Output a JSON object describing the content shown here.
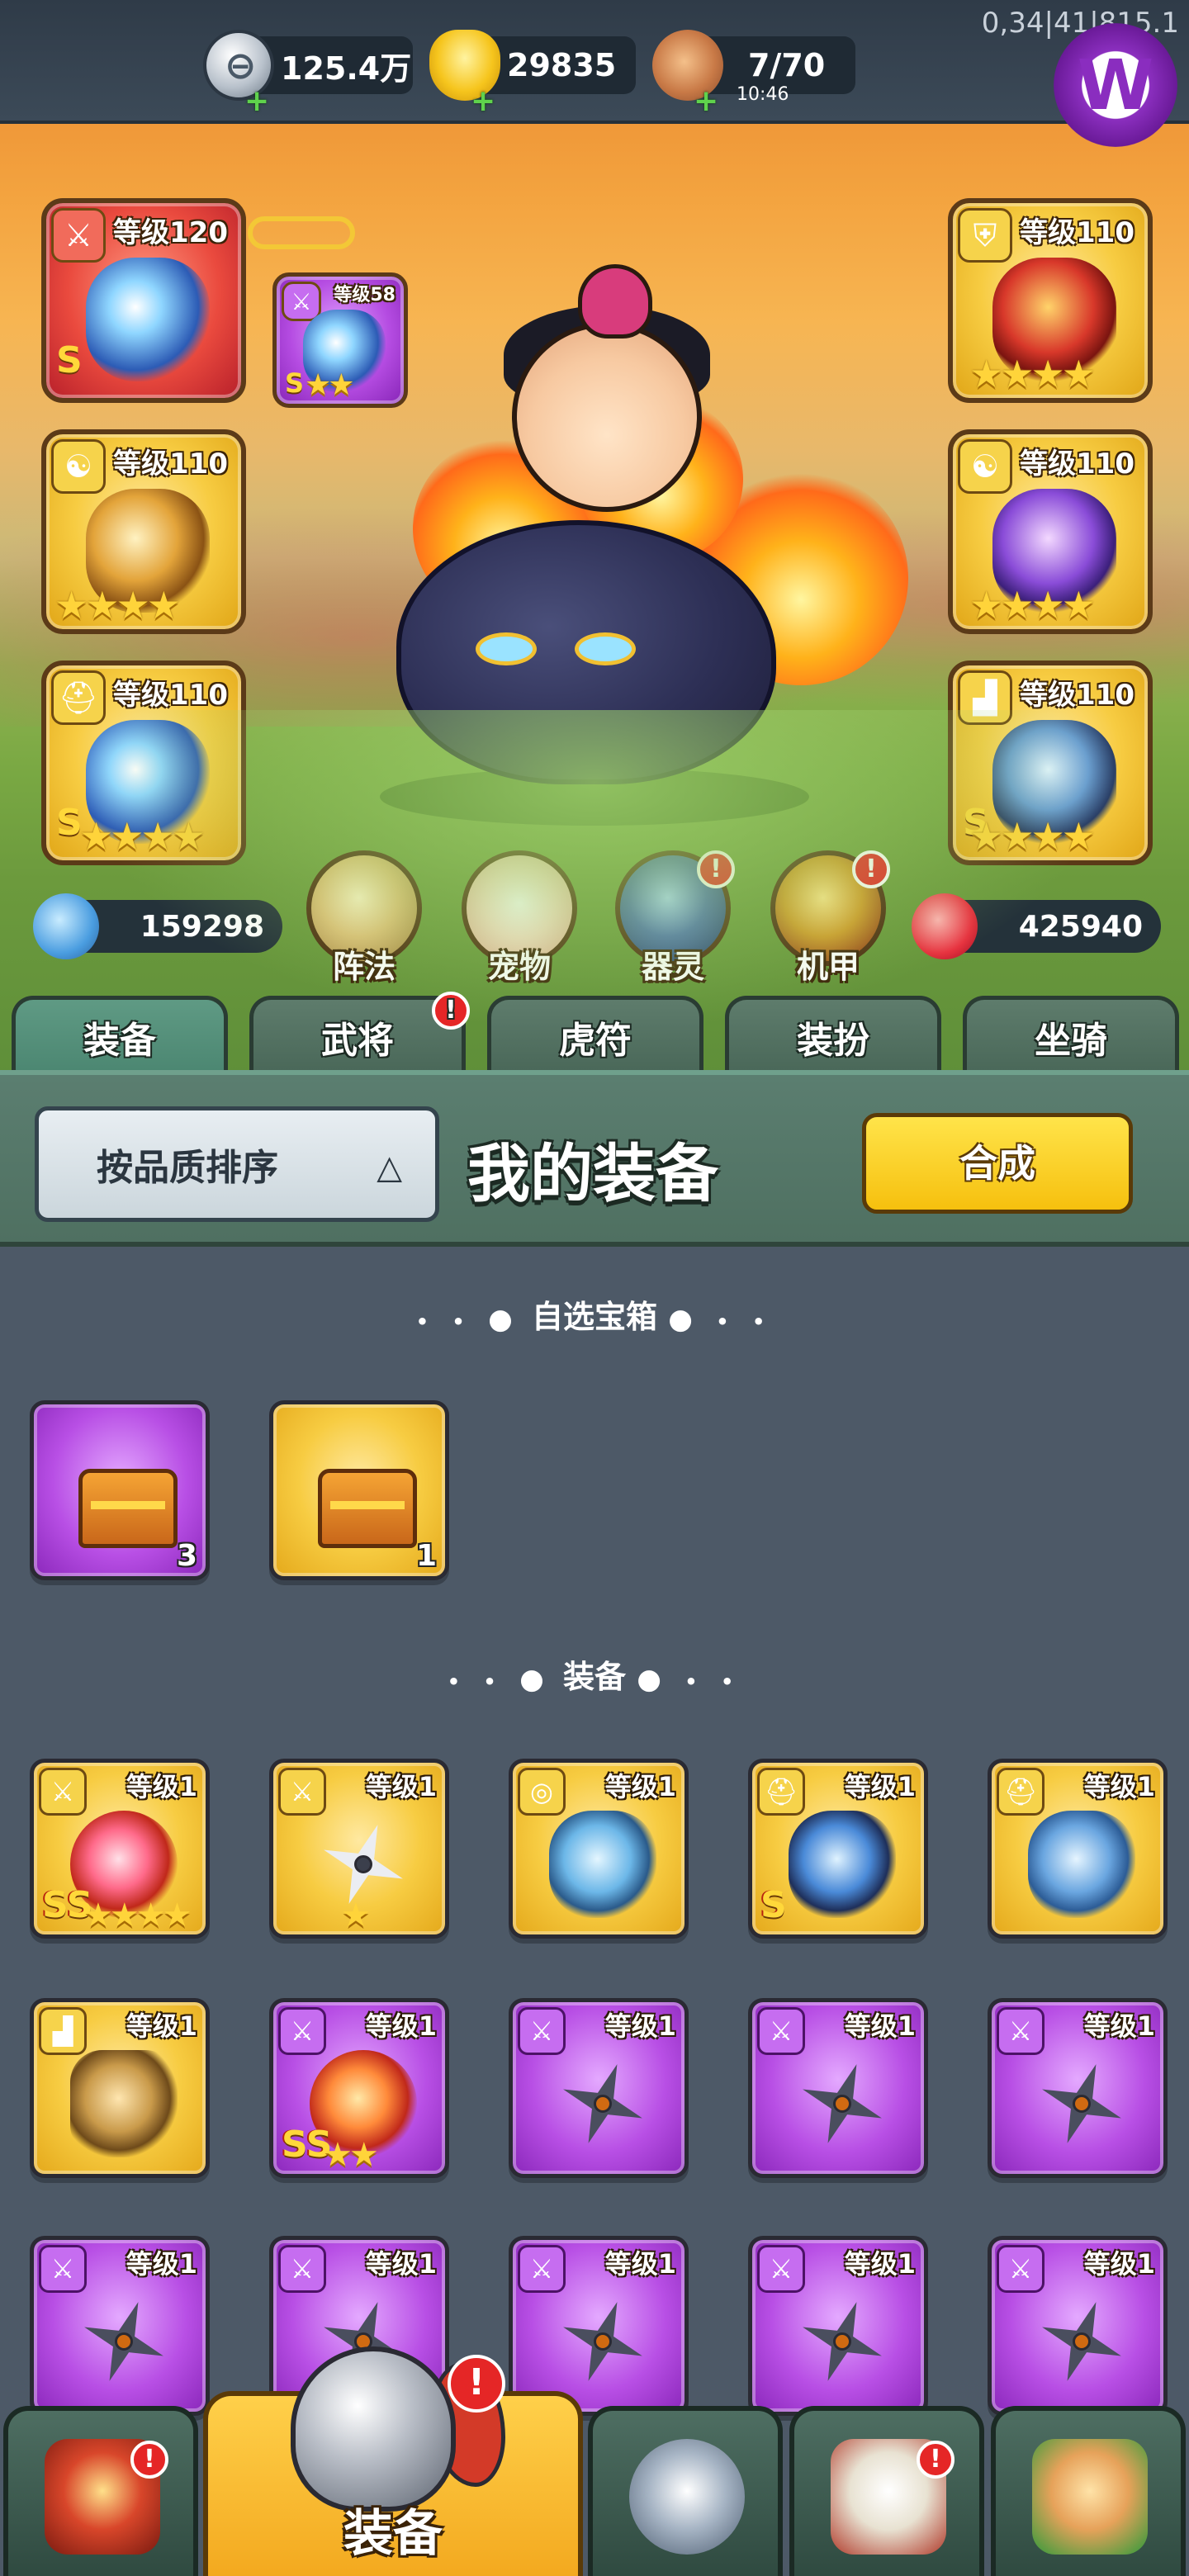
{
  "resources": {
    "silver": {
      "value": "125.4万",
      "icon": "silver-coin-icon"
    },
    "gold": {
      "value": "29835",
      "icon": "gold-ingot-icon"
    },
    "stamina": {
      "value": "7/70",
      "timer": "10:46",
      "icon": "meat-icon"
    }
  },
  "debug_text": "0,34|41|815.1",
  "hero_slots": {
    "weapon": {
      "level": "等级120",
      "grade": "S",
      "icon": "sword-icon"
    },
    "weapon_sub": {
      "level": "等级58",
      "grade": "S",
      "stars": "★★",
      "icon": "sword-icon"
    },
    "armor": {
      "level": "等级110",
      "stars": "★★★★",
      "icon": "armor-icon"
    },
    "accessory_left": {
      "level": "等级110",
      "stars": "★★★★",
      "icon": "yin-yang-icon"
    },
    "accessory_right": {
      "level": "等级110",
      "stars": "★★★★",
      "icon": "yin-yang-icon"
    },
    "helmet": {
      "level": "等级110",
      "grade": "S",
      "stars": "★★★★",
      "icon": "helmet-icon"
    },
    "boots": {
      "level": "等级110",
      "grade": "S",
      "stars": "★★★★",
      "icon": "boot-icon"
    }
  },
  "power": {
    "attack": "159298",
    "hp": "425940"
  },
  "features": [
    {
      "label": "阵法",
      "icon": "formation-icon",
      "alert": false
    },
    {
      "label": "宠物",
      "icon": "pet-cat-icon",
      "alert": false
    },
    {
      "label": "器灵",
      "icon": "spirit-icon",
      "alert": true
    },
    {
      "label": "机甲",
      "icon": "mecha-icon",
      "alert": true
    }
  ],
  "alert_mark": "!",
  "tabs": [
    {
      "label": "装备",
      "active": true,
      "alert": false
    },
    {
      "label": "武将",
      "active": false,
      "alert": true
    },
    {
      "label": "虎符",
      "active": false,
      "alert": false
    },
    {
      "label": "装扮",
      "active": false,
      "alert": false
    },
    {
      "label": "坐骑",
      "active": false,
      "alert": false
    }
  ],
  "panel": {
    "sort_label": "按品质排序",
    "title": "我的装备",
    "compose_label": "合成"
  },
  "sections": {
    "chests_title": "自选宝箱",
    "equipment_title": "装备"
  },
  "chests": [
    {
      "count": "3",
      "rarity": "purple"
    },
    {
      "count": "1",
      "rarity": "gold"
    }
  ],
  "equipment": [
    {
      "level": "等级1",
      "rarity": "gold",
      "icon": "sword-icon",
      "grade": "SS",
      "stars": "★★★★"
    },
    {
      "level": "等级1",
      "rarity": "gold",
      "icon": "sword-icon",
      "grade": "",
      "stars": "★"
    },
    {
      "level": "等级1",
      "rarity": "gold",
      "icon": "medal-icon",
      "grade": "",
      "stars": ""
    },
    {
      "level": "等级1",
      "rarity": "gold",
      "icon": "helmet-icon",
      "grade": "S",
      "stars": ""
    },
    {
      "level": "等级1",
      "rarity": "gold",
      "icon": "helmet-icon",
      "grade": "",
      "stars": ""
    },
    {
      "level": "等级1",
      "rarity": "gold",
      "icon": "boot-icon",
      "grade": "",
      "stars": ""
    },
    {
      "level": "等级1",
      "rarity": "purple",
      "icon": "sword-icon",
      "grade": "SS",
      "stars": "★★"
    },
    {
      "level": "等级1",
      "rarity": "purple",
      "icon": "sword-icon",
      "grade": "",
      "stars": ""
    },
    {
      "level": "等级1",
      "rarity": "purple",
      "icon": "sword-icon",
      "grade": "",
      "stars": ""
    },
    {
      "level": "等级1",
      "rarity": "purple",
      "icon": "sword-icon",
      "grade": "",
      "stars": ""
    },
    {
      "level": "等级1",
      "rarity": "purple",
      "icon": "sword-icon",
      "grade": "",
      "stars": ""
    },
    {
      "level": "等级1",
      "rarity": "purple",
      "icon": "sword-icon",
      "grade": "",
      "stars": ""
    },
    {
      "level": "等级1",
      "rarity": "purple",
      "icon": "sword-icon",
      "grade": "",
      "stars": ""
    },
    {
      "level": "等级1",
      "rarity": "purple",
      "icon": "sword-icon",
      "grade": "",
      "stars": ""
    },
    {
      "level": "等级1",
      "rarity": "purple",
      "icon": "sword-icon",
      "grade": "",
      "stars": ""
    }
  ],
  "dock": [
    {
      "label": "",
      "icon": "gate-icon",
      "alert": true
    },
    {
      "label": "装备",
      "icon": "helmet-icon",
      "alert": true,
      "active": true
    },
    {
      "label": "",
      "icon": "crossed-swords-icon",
      "alert": false
    },
    {
      "label": "",
      "icon": "scroll-icon",
      "alert": true
    },
    {
      "label": "",
      "icon": "fist-upgrade-icon",
      "alert": false
    }
  ],
  "colors": {
    "gold_rarity": "#f7cc42",
    "purple_rarity": "#b84fe5",
    "red_rarity": "#ea4a3e",
    "alert": "#e52626",
    "panel_green": "#5b7e70",
    "inventory_bg": "#4d5967"
  }
}
